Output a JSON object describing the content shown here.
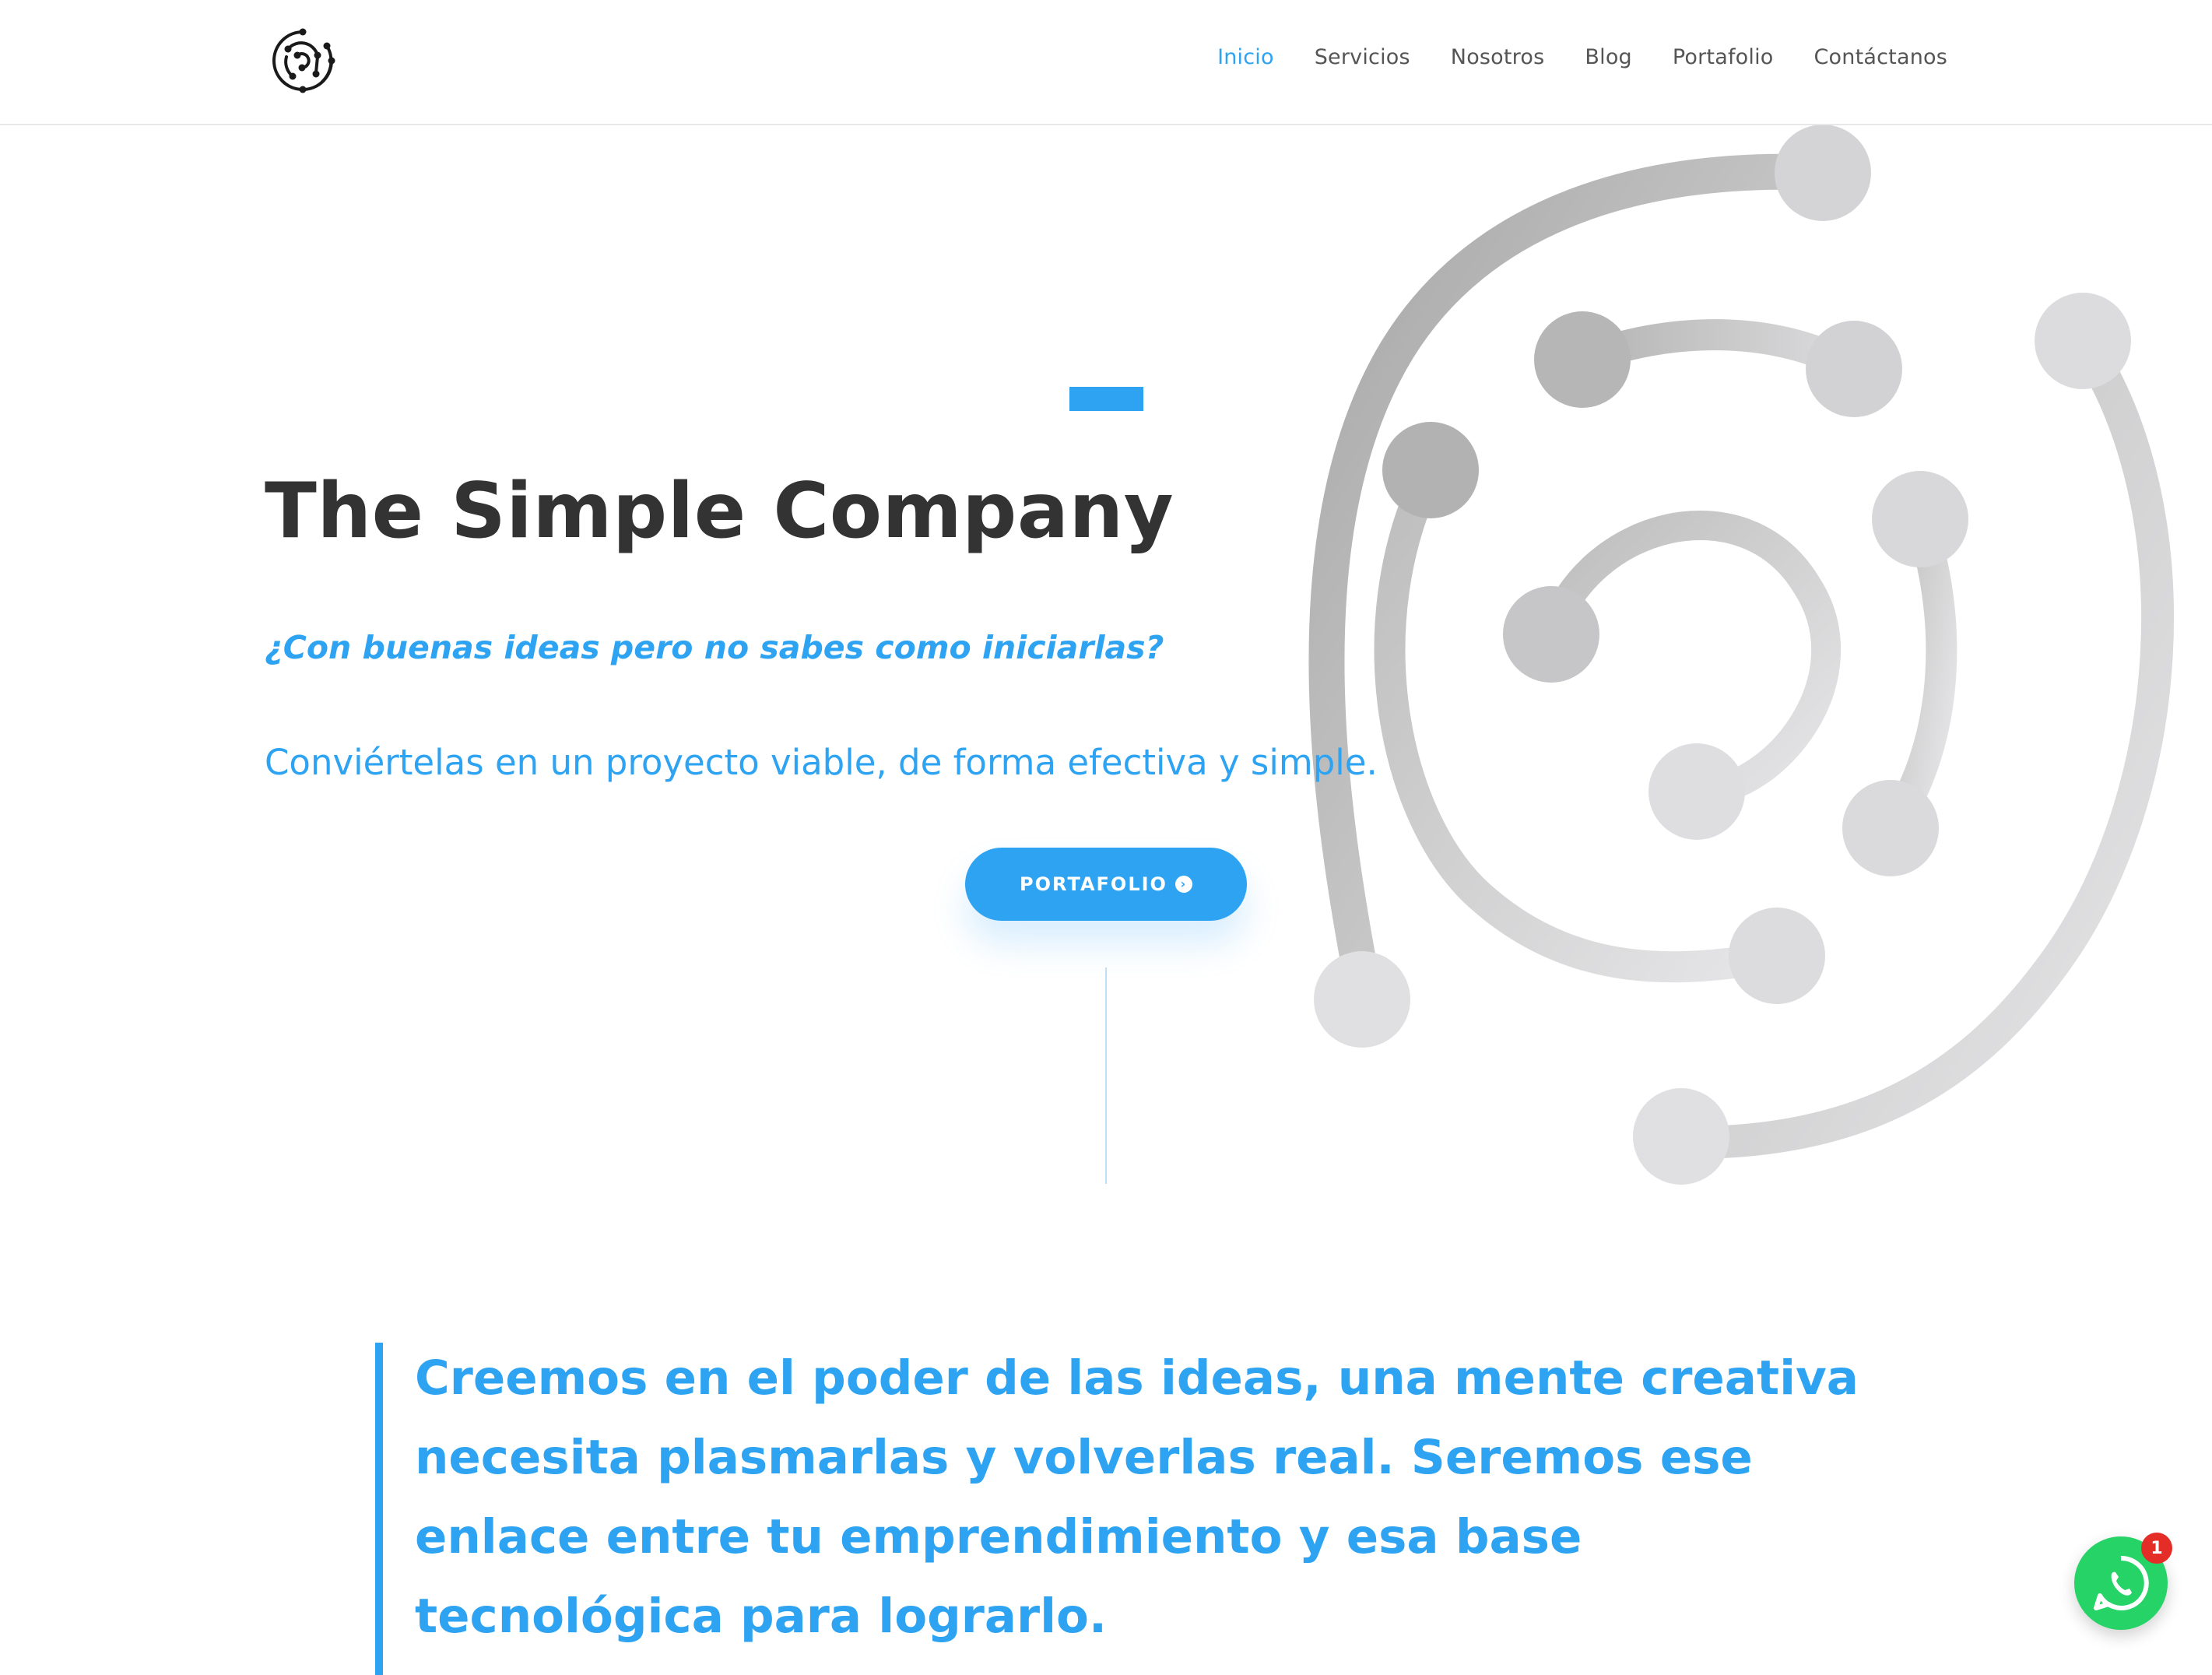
{
  "header": {
    "logo_icon": "circuit-spiral-logo-icon",
    "nav": [
      {
        "label": "Inicio",
        "active": true
      },
      {
        "label": "Servicios",
        "active": false
      },
      {
        "label": "Nosotros",
        "active": false
      },
      {
        "label": "Blog",
        "active": false
      },
      {
        "label": "Portafolio",
        "active": false
      },
      {
        "label": "Contáctanos",
        "active": false
      }
    ]
  },
  "hero": {
    "title": "The Simple Company",
    "question": "¿Con buenas ideas pero no sabes como iniciarlas?",
    "subtitle": "Conviértelas en un proyecto viable, de forma efectiva y simple.",
    "cta_label": "PORTAFOLIO",
    "cta_icon": "chevron-right-circle-icon",
    "graphic_icon": "circuit-spiral-graphic"
  },
  "quote": {
    "text": "Creemos en el poder de las ideas, una mente creativa necesita plasmarlas y volverlas real.  Seremos ese enlace entre tu emprendimiento y esa base tecnológica para lograrlo."
  },
  "whatsapp": {
    "icon": "whatsapp-icon",
    "badge_count": "1"
  },
  "colors": {
    "accent": "#2ea3f2",
    "title": "#333333",
    "nav_text": "#555555",
    "whatsapp": "#25d366",
    "badge": "#e52d27"
  }
}
